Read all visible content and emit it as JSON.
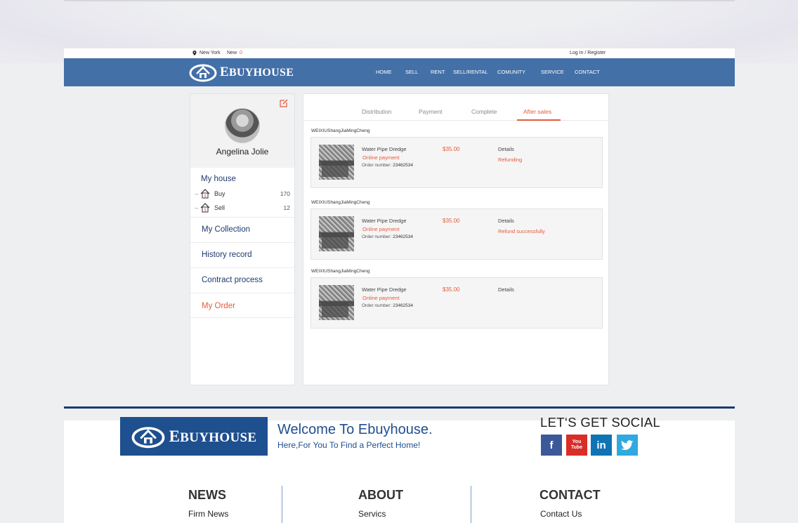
{
  "topbar": {
    "city": "New York",
    "new_label": "New",
    "new_count": "0",
    "login": "Log  In / Register"
  },
  "brand": {
    "logo_first": "E",
    "logo_rest": "BUYHOUSE",
    "color": "#4470a8"
  },
  "nav": [
    "HOME",
    "SELL",
    "RENT",
    "SELL/RENTAL",
    "COMUNITY",
    "SERVICE",
    "CONTACT"
  ],
  "profile": {
    "name": "Angelina Jolie"
  },
  "sidebar": {
    "my_house": "My house",
    "sub": [
      {
        "label": "Buy",
        "count": "170"
      },
      {
        "label": "Sell",
        "count": "12"
      }
    ],
    "items": [
      {
        "label": "My Collection"
      },
      {
        "label": "History record"
      },
      {
        "label": "Contract process"
      },
      {
        "label": "My Order"
      }
    ]
  },
  "tabs": [
    "Distribution",
    "Payment",
    "Complete",
    "After sales"
  ],
  "active_tab": "After sales",
  "orders": [
    {
      "shop": "WEIXIUShangJiaMingCheng",
      "item": "Water Pipe Dredge",
      "payment": "Online payment",
      "order_label": "Order number:",
      "order_no": "23462534",
      "price": "$35.00",
      "details": "Details",
      "status": "Refunding"
    },
    {
      "shop": "WEIXIUShangJiaMingCheng",
      "item": "Water Pipe Dredge",
      "payment": "Online payment",
      "order_label": "Order number:",
      "order_no": "23462534",
      "price": "$35.00",
      "details": "Details",
      "status": "Refund successfully"
    },
    {
      "shop": "WEIXIUShangJiaMingCheng",
      "item": "Water Pipe Dredge",
      "payment": "Online payment",
      "order_label": "Order number:",
      "order_no": "23462534",
      "price": "$35.00",
      "details": "Details",
      "status": ""
    }
  ],
  "footer": {
    "welcome": "Welcome To Ebuyhouse.",
    "welcome_sub": "Here,For You To Find a Perfect Home!",
    "social_title": "LET‘S GET SOCIAL",
    "social": [
      "facebook-icon",
      "youtube-icon",
      "linkedin-icon",
      "twitter-icon"
    ],
    "youtube_line1": "You",
    "youtube_line2": "Tube",
    "columns": [
      {
        "title": "NEWS",
        "link": "Firm News"
      },
      {
        "title": "ABOUT",
        "link": "Servics"
      },
      {
        "title": "CONTACT",
        "link": "Contact Us"
      }
    ],
    "accent": "#1b3a70"
  },
  "colors": {
    "accent": "#e55b3c",
    "link": "#1e3a6e"
  }
}
